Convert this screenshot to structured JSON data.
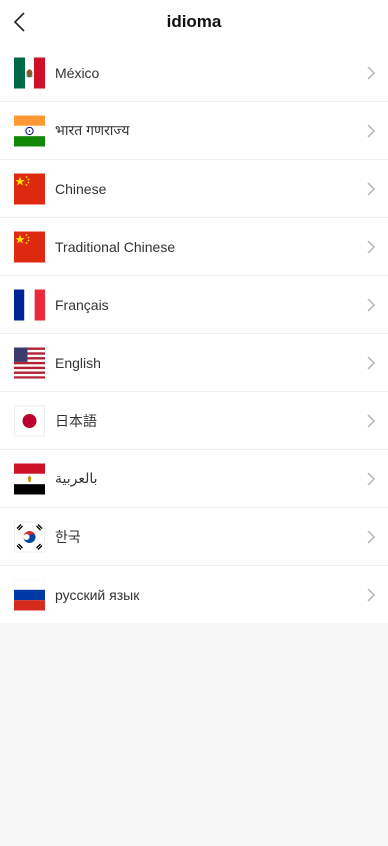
{
  "header": {
    "title": "idioma"
  },
  "languages": [
    {
      "label": "México",
      "flag": "mexico-flag-icon"
    },
    {
      "label": "भारत गणराज्य",
      "flag": "india-flag-icon"
    },
    {
      "label": "Chinese",
      "flag": "china-flag-icon"
    },
    {
      "label": "Traditional Chinese",
      "flag": "china-flag-icon"
    },
    {
      "label": "Français",
      "flag": "france-flag-icon"
    },
    {
      "label": "English",
      "flag": "usa-flag-icon"
    },
    {
      "label": "日本語",
      "flag": "japan-flag-icon"
    },
    {
      "label": "بالعربية",
      "flag": "egypt-flag-icon"
    },
    {
      "label": "한국",
      "flag": "korea-flag-icon"
    },
    {
      "label": "русский язык",
      "flag": "russia-flag-icon"
    }
  ],
  "icons": {
    "back": "chevron-left-icon",
    "row_arrow": "chevron-right-icon"
  }
}
